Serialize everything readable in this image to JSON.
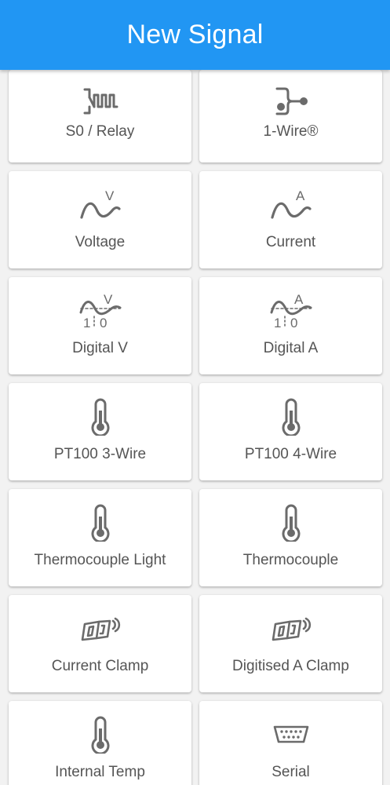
{
  "app_bar": {
    "title": "New Signal"
  },
  "signals": [
    {
      "label": "S0 / Relay",
      "icon": "relay-icon"
    },
    {
      "label": "1-Wire®",
      "icon": "one-wire-icon"
    },
    {
      "label": "Voltage",
      "icon": "voltage-wave-icon"
    },
    {
      "label": "Current",
      "icon": "current-wave-icon"
    },
    {
      "label": "Digital V",
      "icon": "digital-voltage-icon"
    },
    {
      "label": "Digital A",
      "icon": "digital-current-icon"
    },
    {
      "label": "PT100 3-Wire",
      "icon": "thermometer-icon"
    },
    {
      "label": "PT100 4-Wire",
      "icon": "thermometer-icon"
    },
    {
      "label": "Thermocouple Light",
      "icon": "thermometer-icon"
    },
    {
      "label": "Thermocouple",
      "icon": "thermometer-icon"
    },
    {
      "label": "Current Clamp",
      "icon": "current-clamp-icon"
    },
    {
      "label": "Digitised A Clamp",
      "icon": "current-clamp-icon"
    },
    {
      "label": "Internal Temp",
      "icon": "thermometer-icon"
    },
    {
      "label": "Serial",
      "icon": "serial-port-icon"
    }
  ],
  "icon_text": {
    "volt": "V",
    "amp": "A",
    "one": "1",
    "zero": "0"
  },
  "colors": {
    "app_bar": "#2196f3",
    "icon": "#6b6b6b",
    "label": "#555555",
    "background": "#f2f2f2"
  }
}
